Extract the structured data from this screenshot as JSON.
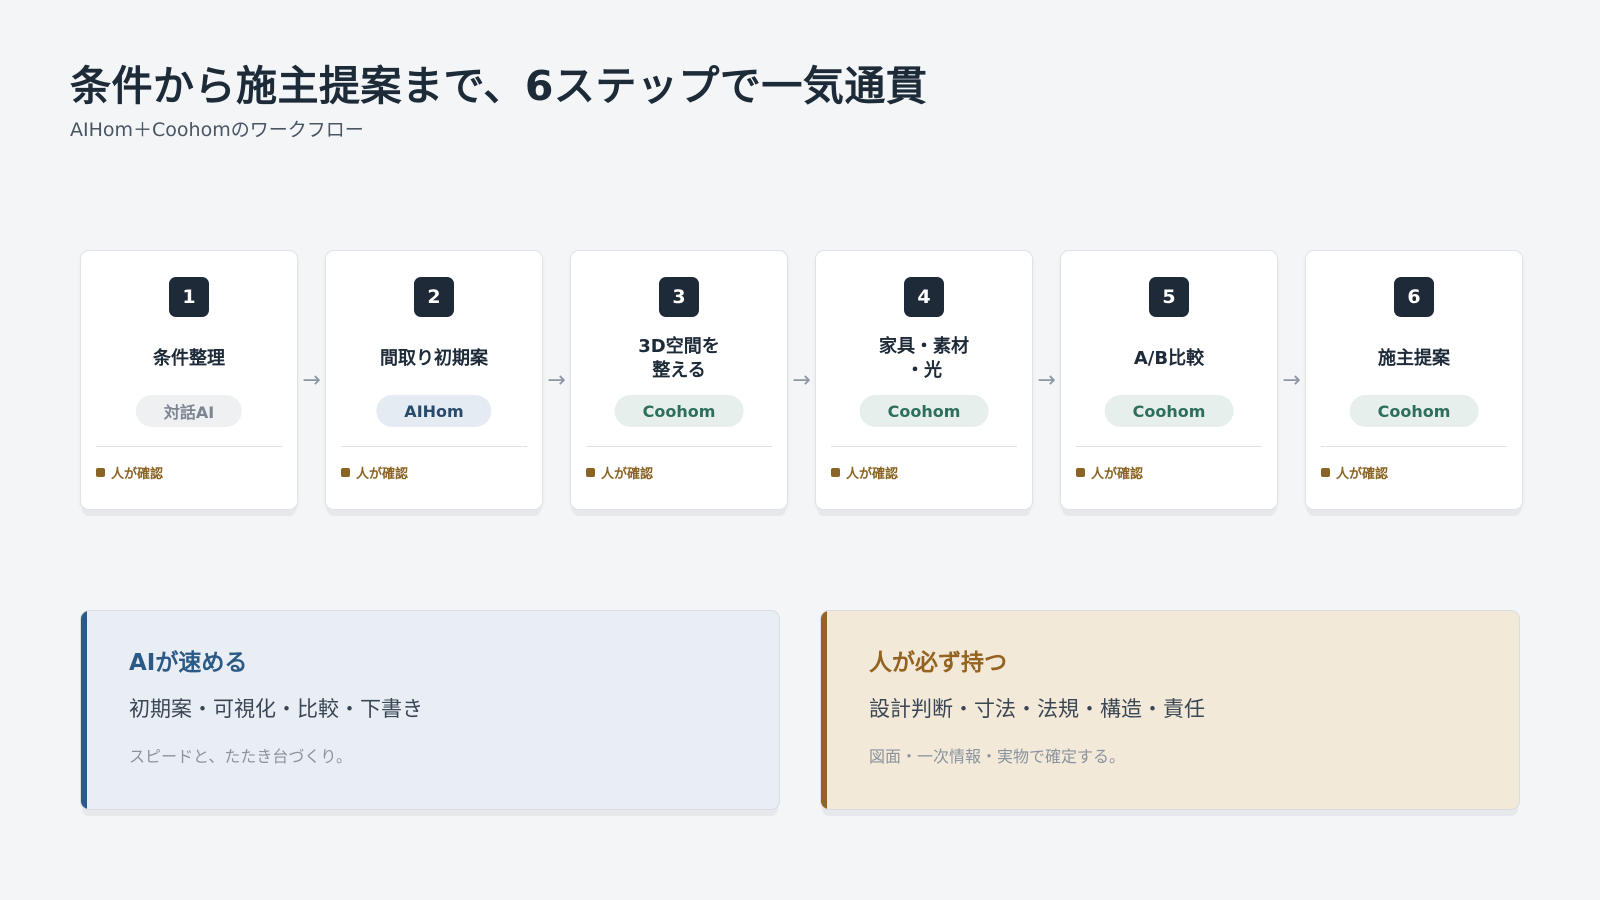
{
  "header": {
    "title": "条件から施主提案まで、6ステップで一気通貫",
    "subtitle": "AIHom＋Coohomのワークフロー"
  },
  "steps": [
    {
      "number": "1",
      "label": "条件整理",
      "tool": "対話AI",
      "tool_style": "gray",
      "check": "人が確認"
    },
    {
      "number": "2",
      "label": "間取り初期案",
      "tool": "AIHom",
      "tool_style": "blue",
      "check": "人が確認"
    },
    {
      "number": "3",
      "label": "3D空間を\n整える",
      "tool": "Coohom",
      "tool_style": "green",
      "check": "人が確認"
    },
    {
      "number": "4",
      "label": "家具・素材\n・光",
      "tool": "Coohom",
      "tool_style": "green",
      "check": "人が確認"
    },
    {
      "number": "5",
      "label": "A/B比較",
      "tool": "Coohom",
      "tool_style": "green",
      "check": "人が確認"
    },
    {
      "number": "6",
      "label": "施主提案",
      "tool": "Coohom",
      "tool_style": "green",
      "check": "人が確認"
    }
  ],
  "panels": {
    "ai": {
      "title": "AIが速める",
      "body": "初期案・可視化・比較・下書き",
      "note": "スピードと、たたき台づくり。"
    },
    "human": {
      "title": "人が必ず持つ",
      "body": "設計判断・寸法・法規・構造・責任",
      "note": "図面・一次情報・実物で確定する。"
    }
  },
  "colors": {
    "dark": "#1e2a38",
    "ai_accent": "#2b5a86",
    "human_accent": "#946320",
    "check": "#8a6424"
  }
}
